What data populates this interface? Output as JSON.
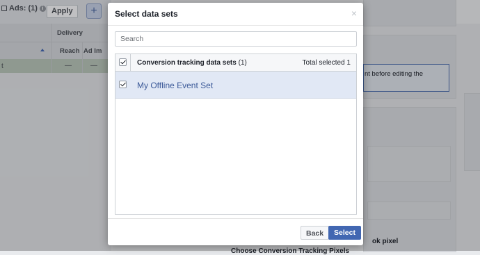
{
  "background": {
    "toolbar": {
      "ads_label": "Ads: (1)",
      "info": "i",
      "apply_label": "Apply",
      "add_label": "+"
    },
    "table": {
      "group_header": "Delivery",
      "columns": [
        "Reach",
        "Ad Im"
      ],
      "row_prefix": "t",
      "row_values": [
        "—",
        "—"
      ]
    },
    "right_panel": {
      "notice_line1": "nt before editing the",
      "notice_line2": "",
      "bottom_line1": "ok pixel",
      "bottom_line2": "Choose Conversion Tracking Pixels"
    }
  },
  "modal": {
    "title": "Select data sets",
    "close_icon": "×",
    "search_placeholder": "Search",
    "table_header_label": "Conversion tracking data sets",
    "table_header_count": "(1)",
    "total_selected": "Total selected 1",
    "rows": [
      {
        "label": "My Offline Event Set",
        "checked": true
      }
    ],
    "back_label": "Back",
    "select_label": "Select"
  },
  "colors": {
    "primary": "#4267b2",
    "link": "#3b5998",
    "selected_row": "#e1e8f5"
  }
}
